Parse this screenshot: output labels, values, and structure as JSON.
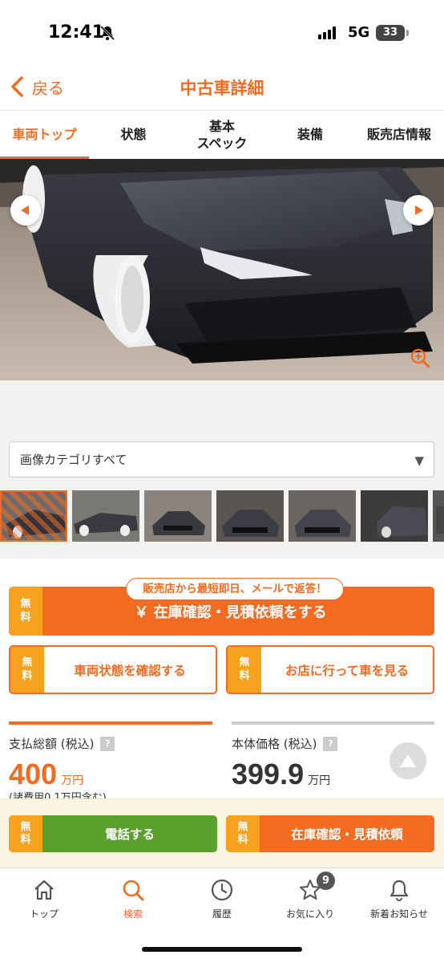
{
  "status_bar": {
    "time": "12:41",
    "network": "5G",
    "battery": "33"
  },
  "header": {
    "back_label": "戻る",
    "title": "中古車詳細"
  },
  "tabs": [
    {
      "label": "車両トップ",
      "active": true
    },
    {
      "label": "状態",
      "active": false
    },
    {
      "label": "基本\nスペック",
      "active": false
    },
    {
      "label": "装備",
      "active": false
    },
    {
      "label": "販売店情報",
      "active": false
    }
  ],
  "gallery": {
    "category_select": "画像カテゴリすべて",
    "thumbnail_count": 7,
    "selected_index": 0
  },
  "cta": {
    "bubble": "販売店から最短即日、メールで返答！",
    "free_tag": "無\n料",
    "main_label": "￥ 在庫確認・見積依頼をする",
    "check_condition": "車両状態を確認する",
    "visit_store": "お店に行って車を見る"
  },
  "price": {
    "total_label": "支払総額 (税込)",
    "total_value": "400",
    "total_unit": "万円",
    "total_note": "(諸費用0.1万円含む)",
    "base_label": "本体価格 (税込)",
    "base_value": "399.9",
    "base_unit": "万円",
    "help": "?"
  },
  "action_bar": {
    "call_label": "電話する",
    "inquiry_label": "在庫確認・見積依頼"
  },
  "bottom_nav": [
    {
      "label": "トップ",
      "icon": "home-icon"
    },
    {
      "label": "検索",
      "icon": "search-icon",
      "active": true
    },
    {
      "label": "履歴",
      "icon": "clock-icon"
    },
    {
      "label": "お気に入り",
      "icon": "star-icon",
      "badge": "9"
    },
    {
      "label": "新着お知らせ",
      "icon": "bell-icon"
    }
  ],
  "colors": {
    "accent": "#f26b21",
    "free_tag": "#f7a21e",
    "call_green": "#5aa02c"
  }
}
